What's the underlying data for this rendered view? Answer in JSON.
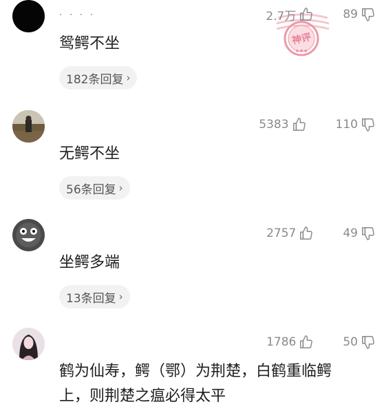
{
  "comments": [
    {
      "username": "· · · ·",
      "likes": "2.7万",
      "dislikes": "89",
      "text": "鸳鳄不坐",
      "replies": "182条回复",
      "badge": "神评"
    },
    {
      "username": "",
      "likes": "5383",
      "dislikes": "110",
      "text": "无鳄不坐",
      "replies": "56条回复"
    },
    {
      "username": "",
      "likes": "2757",
      "dislikes": "49",
      "text": "坐鳄多端",
      "replies": "13条回复"
    },
    {
      "username": "",
      "likes": "1786",
      "dislikes": "50",
      "text_line1": "鹤为仙寿，鳄（鄂）为荆楚，白鹤重临鳄",
      "text_line2": "上，则荆楚之瘟必得太平"
    }
  ],
  "icons": {
    "like": "thumbs-up-icon",
    "dislike": "thumbs-down-icon",
    "chevron": "chevron-right-icon",
    "stamp": "hot-comment-stamp"
  },
  "colors": {
    "text": "#1e1e1e",
    "muted": "#8a8a8a",
    "pill_bg": "#f2f2f2",
    "stamp": "#e8788a"
  }
}
